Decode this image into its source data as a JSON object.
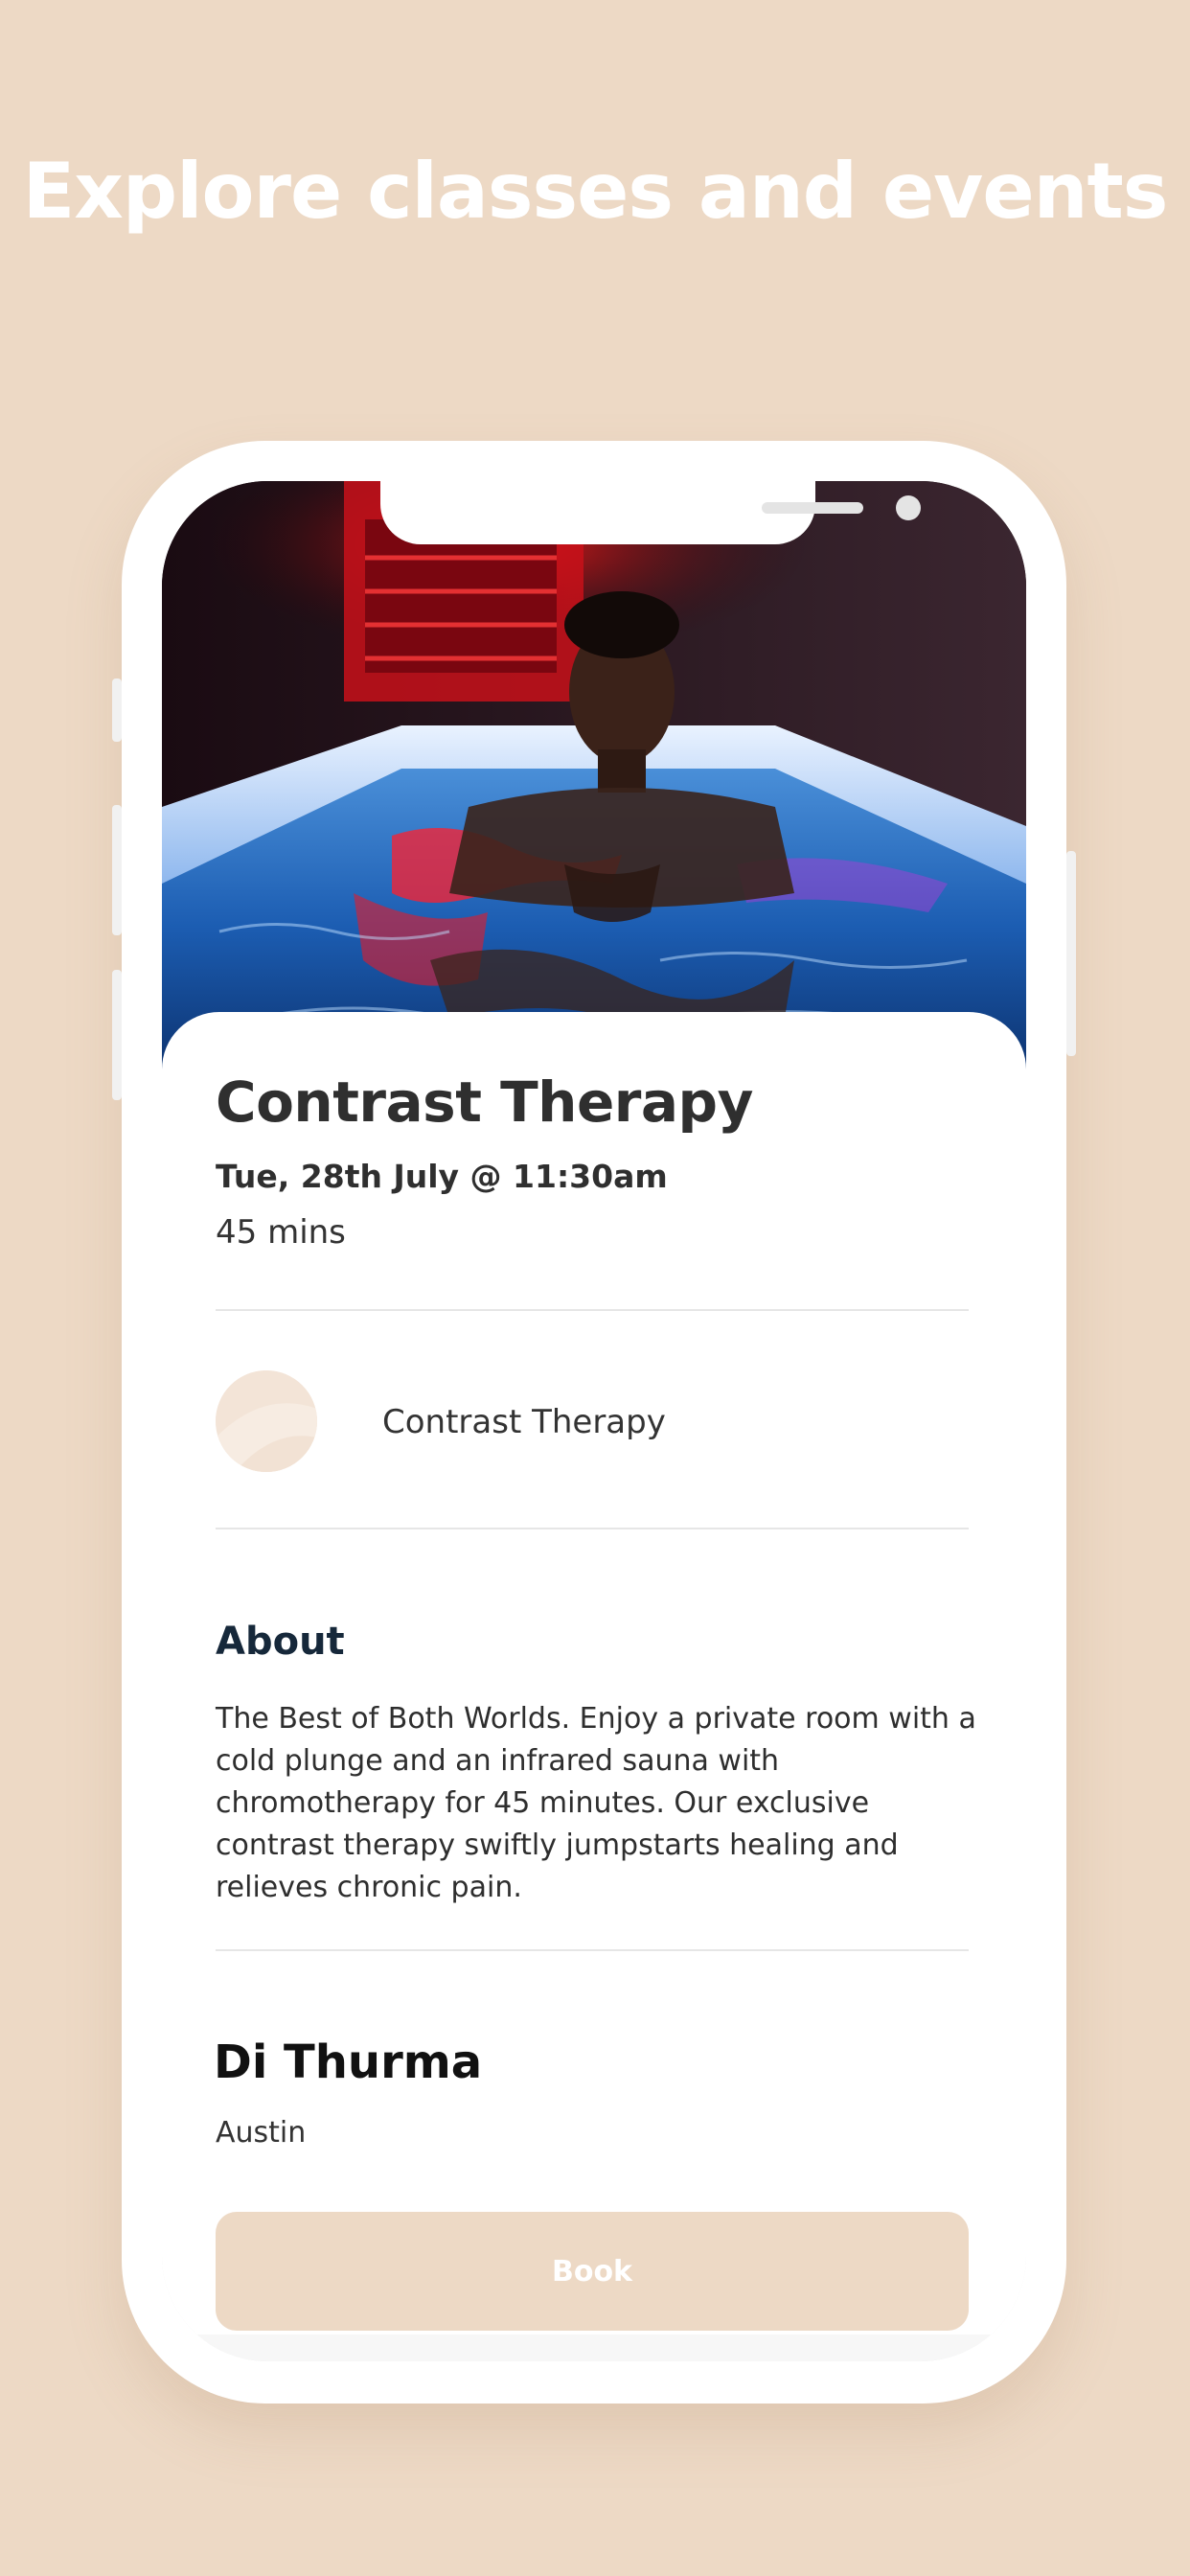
{
  "headline": "Explore classes and events",
  "event": {
    "title": "Contrast Therapy",
    "datetime": "Tue, 28th July @ 11:30am",
    "duration": "45 mins"
  },
  "instructor": {
    "name": "Contrast Therapy"
  },
  "about": {
    "heading": "About",
    "text": "The Best of Both Worlds. Enjoy a private room with a cold plunge and an infrared sauna with chromotherapy for 45 minutes. Our exclusive contrast therapy swiftly jumpstarts healing and relieves chronic pain."
  },
  "venue": {
    "name": "Di Thurma",
    "location": "Austin"
  },
  "actions": {
    "book_label": "Book"
  },
  "colors": {
    "background": "#EDD9C5",
    "accent": "#EDD9C5",
    "text": "#2f2f2f"
  }
}
